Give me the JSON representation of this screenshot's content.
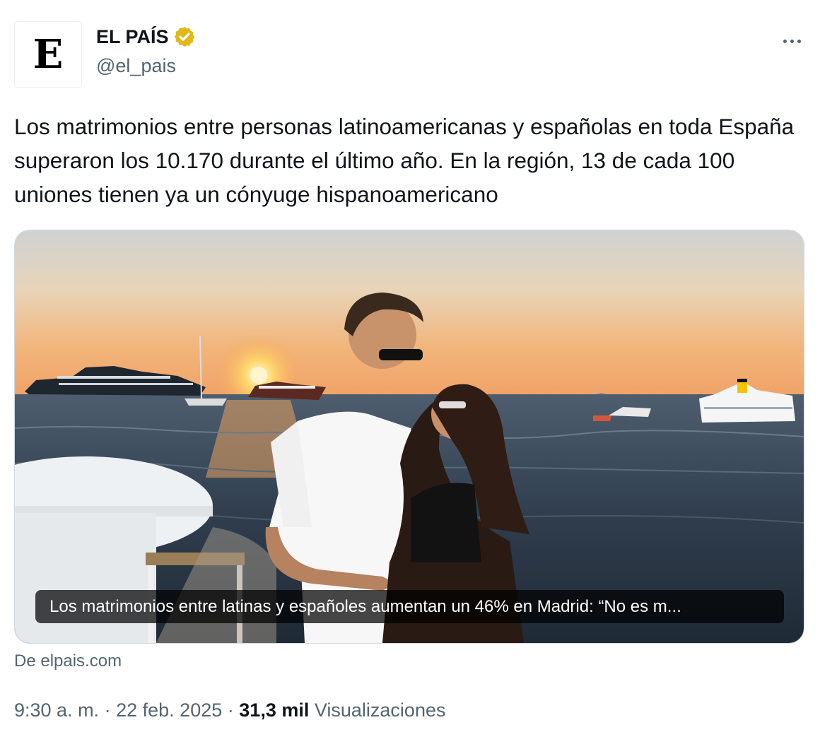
{
  "author": {
    "avatar_letter": "E",
    "name": "EL PAÍS",
    "handle": "@el_pais",
    "verified_color": "#e2b719"
  },
  "more_icon": "more-horizontal-icon",
  "tweet": {
    "text": "Los matrimonios entre personas latinoamericanas y españolas en toda España superaron los 10.170 durante el último año. En la región, 13 de cada 100 uniones tienen ya un cónyuge hispanoamericano"
  },
  "card": {
    "image_description_icon": "sunset-couple-photo",
    "caption": "Los matrimonios entre latinas y españoles aumentan un 46% en Madrid: “No es m...",
    "source": "De elpais.com"
  },
  "meta": {
    "time": "9:30 a. m.",
    "separator": "·",
    "date": "22 feb. 2025",
    "views_count": "31,3 mil",
    "views_label": "Visualizaciones"
  },
  "colors": {
    "text_primary": "#0f1419",
    "text_secondary": "#536471",
    "border": "#cfd9de"
  }
}
